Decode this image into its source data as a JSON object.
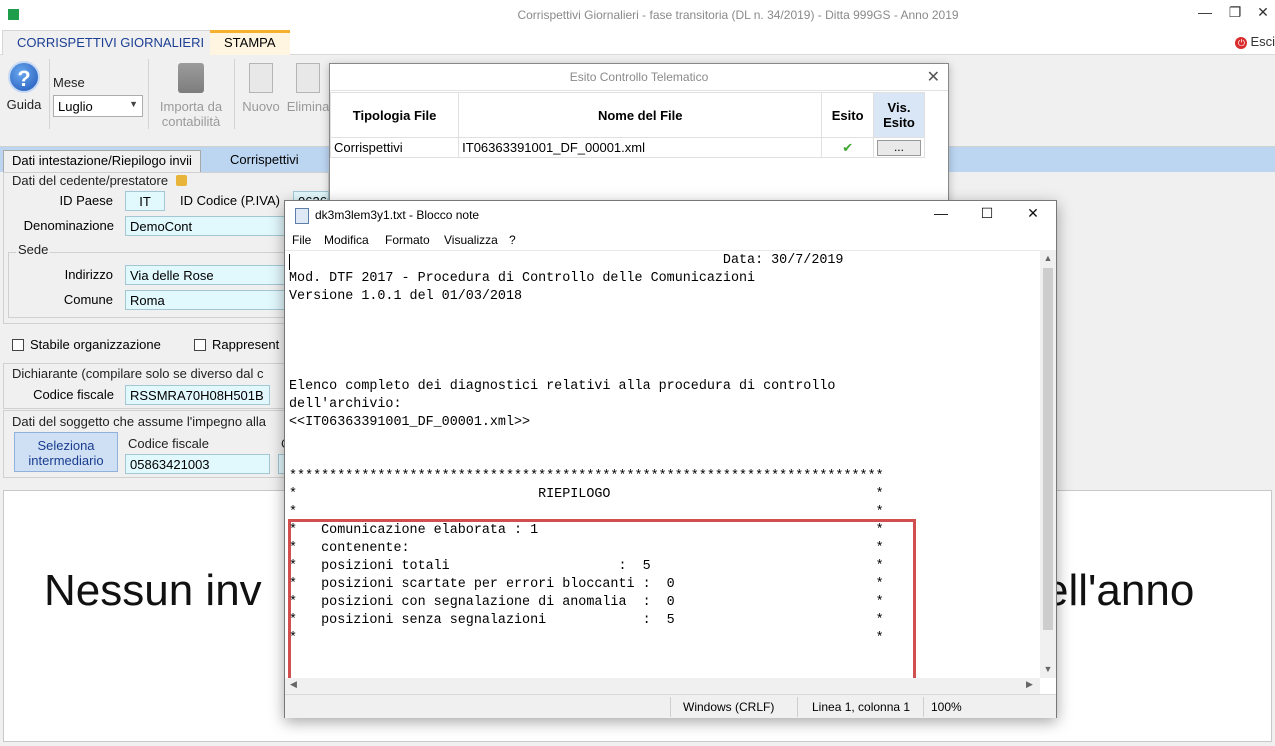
{
  "window": {
    "title": "Corrispettivi Giornalieri - fase transitoria (DL n. 34/2019) - Ditta 999GS - Anno 2019",
    "controls": [
      "—",
      "❐",
      "✕"
    ]
  },
  "ribbon_tabs": [
    "CORRISPETTIVI GIORNALIERI",
    "STAMPA"
  ],
  "exit_label": "Esci",
  "ribbon": {
    "guida": "Guida",
    "mese_label": "Mese",
    "mese_value": "Luglio",
    "importa": "Importa da contabilità",
    "nuovo": "Nuovo",
    "elimina": "Elimina"
  },
  "content_tabs": [
    "Dati intestazione/Riepilogo invii",
    "Corrispettivi"
  ],
  "form": {
    "cedente_title": "Dati del cedente/prestatore",
    "id_paese_label": "ID Paese",
    "id_paese_value": "IT",
    "id_codice_label": "ID Codice (P.IVA)",
    "id_codice_value": "06363",
    "denominazione_label": "Denominazione",
    "denominazione_value": "DemoCont",
    "sede_title": "Sede",
    "indirizzo_label": "Indirizzo",
    "indirizzo_value": "Via delle Rose",
    "comune_label": "Comune",
    "comune_value": "Roma",
    "stabile": "Stabile organizzazione",
    "rappresent": "Rappresent",
    "dichiarante_title": "Dichiarante (compilare solo se diverso dal c",
    "cf_label": "Codice fiscale",
    "cf_value": "RSSMRA70H08H501B",
    "impegno_title": "Dati del soggetto che assume l'impegno alla",
    "seleziona_btn": "Seleziona intermediario",
    "cf2_label": "Codice fiscale",
    "cf2_value": "05863421003",
    "cf2_extra": "C"
  },
  "big_message_start": "Nessun inv",
  "big_message_end": "ell'anno",
  "esito_dialog": {
    "title": "Esito Controllo Telematico",
    "close": "✕",
    "headers": [
      "Tipologia File",
      "Nome del File",
      "Esito",
      "Vis. Esito"
    ],
    "rows": [
      {
        "tipologia": "Corrispettivi",
        "nome": "IT06363391001_DF_00001.xml",
        "esito": "✔",
        "vis": "..."
      }
    ]
  },
  "notepad": {
    "title": "dk3m3lem3y1.txt - Blocco note",
    "menu": [
      "File",
      "Modifica",
      "Formato",
      "Visualizza",
      "?"
    ],
    "lines": [
      "                                                      Data: 30/7/2019",
      "Mod. DTF 2017 - Procedura di Controllo delle Comunicazioni",
      "Versione 1.0.1 del 01/03/2018",
      "",
      "",
      "",
      "",
      "Elenco completo dei diagnostici relativi alla procedura di controllo",
      "dell'archivio:",
      "<<IT06363391001_DF_00001.xml>>",
      "",
      "",
      "**************************************************************************",
      "*                              RIEPILOGO                                 *",
      "*                                                                        *",
      "*   Comunicazione elaborata : 1                                          *",
      "*   contenente:                                                          *",
      "*   posizioni totali                     :  5                            *",
      "*   posizioni scartate per errori bloccanti :  0                         *",
      "*   posizioni con segnalazione di anomalia  :  0                         *",
      "*   posizioni senza segnalazioni            :  5                         *",
      "*                                                                        *"
    ],
    "status": {
      "encoding": "Windows (CRLF)",
      "position": "Linea 1, colonna 1",
      "zoom": "100%"
    }
  }
}
